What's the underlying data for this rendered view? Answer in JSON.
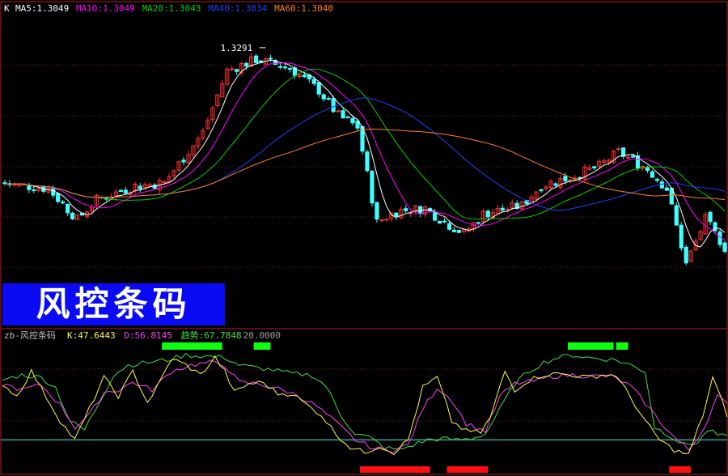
{
  "colors": {
    "background": "#000000",
    "grid": "#7a2020",
    "frame": "#b02020",
    "up": "#ff3030",
    "down": "#40ffff",
    "ma5": "#ffffff",
    "ma10": "#ff00ff",
    "ma20": "#00d000",
    "ma40": "#2040ff",
    "ma60": "#ff8020",
    "k": "#ffff40",
    "d": "#ff40ff",
    "trend": "#40e040",
    "level": "#40a0a0",
    "top_bar": "#10ff10",
    "bottom_bar": "#ff1010",
    "banner": "#0a0af5"
  },
  "price_panel": {
    "prefix": "K",
    "legend": [
      {
        "label": "MA5:1.3049",
        "color": "#ffffff"
      },
      {
        "label": "MA10:1.3049",
        "color": "#ff00ff"
      },
      {
        "label": "MA20:1.3043",
        "color": "#00d000"
      },
      {
        "label": "MA40:1.3034",
        "color": "#2040ff"
      },
      {
        "label": "MA60:1.3040",
        "color": "#ff8020"
      }
    ],
    "high_label": "1.3291"
  },
  "banner": {
    "text": "风控条码"
  },
  "indicator_panel": {
    "title": "zb-风控条码",
    "legend": [
      {
        "label": "K:47.6443",
        "color": "#ffff40"
      },
      {
        "label": "D:56.8145",
        "color": "#ff40ff"
      },
      {
        "label": "趋势:67.7848",
        "color": "#40e040"
      },
      {
        "label": "20.0000",
        "color": "#a0a0a0"
      }
    ]
  },
  "chart_data": {
    "type": "candlestick",
    "bar_count": 150,
    "x_range": [
      0,
      150
    ],
    "price_ylim": [
      1.29,
      1.335
    ],
    "highest_marker": {
      "bar": 54,
      "value": 1.3291
    },
    "price_path": [
      [
        0,
        1.305
      ],
      [
        10,
        1.304
      ],
      [
        16,
        1.2985
      ],
      [
        20,
        1.302
      ],
      [
        28,
        1.3045
      ],
      [
        34,
        1.305
      ],
      [
        42,
        1.314
      ],
      [
        47,
        1.325
      ],
      [
        53,
        1.327
      ],
      [
        60,
        1.3255
      ],
      [
        66,
        1.3215
      ],
      [
        70,
        1.317
      ],
      [
        74,
        1.315
      ],
      [
        78,
        1.298
      ],
      [
        82,
        1.3
      ],
      [
        88,
        1.3005
      ],
      [
        92,
        1.298
      ],
      [
        96,
        1.296
      ],
      [
        100,
        1.2995
      ],
      [
        108,
        1.301
      ],
      [
        112,
        1.3045
      ],
      [
        118,
        1.306
      ],
      [
        124,
        1.308
      ],
      [
        128,
        1.3105
      ],
      [
        134,
        1.3075
      ],
      [
        138,
        1.304
      ],
      [
        142,
        1.2905
      ],
      [
        146,
        1.2985
      ],
      [
        150,
        1.2935
      ]
    ],
    "indicator_ylim": [
      -5,
      100
    ],
    "level": 20,
    "k_path": [
      [
        0,
        65
      ],
      [
        3,
        55
      ],
      [
        6,
        75
      ],
      [
        9,
        55
      ],
      [
        12,
        35
      ],
      [
        15,
        20
      ],
      [
        18,
        45
      ],
      [
        21,
        70
      ],
      [
        24,
        55
      ],
      [
        27,
        75
      ],
      [
        30,
        50
      ],
      [
        32,
        62
      ],
      [
        35,
        85
      ],
      [
        38,
        80
      ],
      [
        41,
        72
      ],
      [
        44,
        86
      ],
      [
        46,
        75
      ],
      [
        48,
        58
      ],
      [
        51,
        65
      ],
      [
        54,
        66
      ],
      [
        57,
        57
      ],
      [
        60,
        57
      ],
      [
        63,
        48
      ],
      [
        66,
        40
      ],
      [
        69,
        25
      ],
      [
        72,
        14
      ],
      [
        75,
        10
      ],
      [
        78,
        15
      ],
      [
        81,
        10
      ],
      [
        84,
        20
      ],
      [
        87,
        62
      ],
      [
        90,
        70
      ],
      [
        93,
        35
      ],
      [
        96,
        27
      ],
      [
        99,
        26
      ],
      [
        101,
        38
      ],
      [
        104,
        75
      ],
      [
        106,
        60
      ],
      [
        109,
        68
      ],
      [
        112,
        72
      ],
      [
        115,
        73
      ],
      [
        118,
        72
      ],
      [
        121,
        70
      ],
      [
        124,
        72
      ],
      [
        127,
        72
      ],
      [
        130,
        54
      ],
      [
        133,
        35
      ],
      [
        136,
        20
      ],
      [
        139,
        12
      ],
      [
        142,
        8
      ],
      [
        145,
        40
      ],
      [
        147,
        70
      ],
      [
        150,
        40
      ]
    ],
    "d_path": [
      [
        0,
        65
      ],
      [
        4,
        60
      ],
      [
        8,
        64
      ],
      [
        12,
        48
      ],
      [
        15,
        30
      ],
      [
        18,
        40
      ],
      [
        21,
        58
      ],
      [
        24,
        60
      ],
      [
        27,
        66
      ],
      [
        31,
        60
      ],
      [
        35,
        75
      ],
      [
        39,
        80
      ],
      [
        43,
        82
      ],
      [
        46,
        80
      ],
      [
        49,
        66
      ],
      [
        53,
        65
      ],
      [
        57,
        61
      ],
      [
        61,
        56
      ],
      [
        65,
        47
      ],
      [
        69,
        34
      ],
      [
        73,
        20
      ],
      [
        77,
        13
      ],
      [
        81,
        12
      ],
      [
        84,
        16
      ],
      [
        87,
        45
      ],
      [
        90,
        62
      ],
      [
        93,
        52
      ],
      [
        96,
        33
      ],
      [
        100,
        27
      ],
      [
        103,
        55
      ],
      [
        106,
        65
      ],
      [
        110,
        67
      ],
      [
        114,
        71
      ],
      [
        118,
        72
      ],
      [
        122,
        71
      ],
      [
        126,
        71
      ],
      [
        130,
        63
      ],
      [
        134,
        45
      ],
      [
        138,
        26
      ],
      [
        142,
        12
      ],
      [
        145,
        28
      ],
      [
        148,
        55
      ],
      [
        150,
        48
      ]
    ],
    "trend_path": [
      [
        0,
        68
      ],
      [
        4,
        72
      ],
      [
        8,
        70
      ],
      [
        11,
        62
      ],
      [
        14,
        35
      ],
      [
        17,
        28
      ],
      [
        20,
        50
      ],
      [
        23,
        72
      ],
      [
        26,
        80
      ],
      [
        30,
        82
      ],
      [
        34,
        84
      ],
      [
        38,
        88
      ],
      [
        42,
        87
      ],
      [
        46,
        86
      ],
      [
        49,
        80
      ],
      [
        52,
        78
      ],
      [
        56,
        76
      ],
      [
        60,
        73
      ],
      [
        64,
        72
      ],
      [
        67,
        63
      ],
      [
        70,
        40
      ],
      [
        73,
        25
      ],
      [
        76,
        22
      ],
      [
        79,
        14
      ],
      [
        82,
        12
      ],
      [
        85,
        16
      ],
      [
        88,
        20
      ],
      [
        91,
        21
      ],
      [
        94,
        20
      ],
      [
        97,
        21
      ],
      [
        100,
        25
      ],
      [
        103,
        45
      ],
      [
        106,
        65
      ],
      [
        109,
        75
      ],
      [
        112,
        82
      ],
      [
        115,
        86
      ],
      [
        118,
        88
      ],
      [
        121,
        86
      ],
      [
        124,
        85
      ],
      [
        127,
        84
      ],
      [
        130,
        80
      ],
      [
        133,
        75
      ],
      [
        135,
        30
      ],
      [
        138,
        24
      ],
      [
        141,
        16
      ],
      [
        144,
        18
      ],
      [
        146,
        28
      ],
      [
        148,
        24
      ],
      [
        150,
        22
      ]
    ],
    "top_signals": [
      [
        33,
        46
      ],
      [
        52,
        56
      ],
      [
        117,
        127
      ],
      [
        127,
        130
      ]
    ],
    "bottom_signals": [
      [
        74,
        89
      ],
      [
        92,
        101
      ],
      [
        138,
        143
      ]
    ]
  }
}
